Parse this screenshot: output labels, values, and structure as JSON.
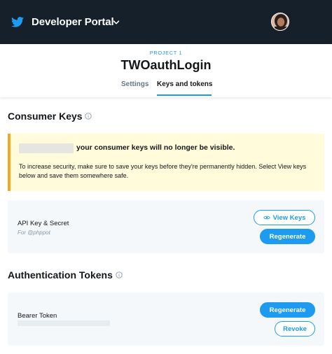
{
  "topbar": {
    "brand": "Developer Portal",
    "brand_icon": "twitter-bird-icon",
    "colors": {
      "background": "#15202b",
      "accent": "#1d9bf0"
    }
  },
  "project": {
    "label": "PROJECT 1",
    "title": "TWOauthLogin",
    "tabs": [
      {
        "label": "Settings",
        "active": false
      },
      {
        "label": "Keys and tokens",
        "active": true
      }
    ]
  },
  "consumer_keys": {
    "title": "Consumer Keys",
    "warning": {
      "headline": "your consumer keys will no longer be visible.",
      "body": "To increase security, make sure to save your keys before they're permanently hidden. Select View keys below and save them somewhere safe.",
      "colors": {
        "background": "#fffbdb",
        "border": "#f5a623"
      }
    },
    "api_key": {
      "label": "API Key & Secret",
      "sub": "For @phppot",
      "view_button": "View Keys",
      "regenerate_button": "Regenerate"
    }
  },
  "auth_tokens": {
    "title": "Authentication Tokens",
    "bearer": {
      "label": "Bearer Token",
      "regenerate_button": "Regenerate",
      "revoke_button": "Revoke"
    }
  }
}
